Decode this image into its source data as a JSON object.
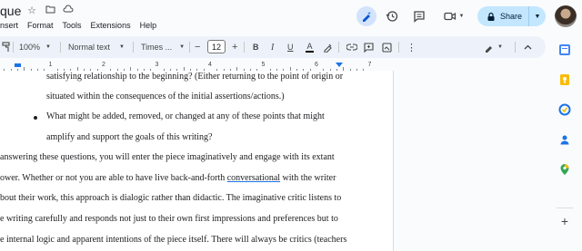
{
  "header": {
    "doc_title": "que",
    "menu": [
      "nsert",
      "Format",
      "Tools",
      "Extensions",
      "Help"
    ],
    "share_label": "Share"
  },
  "toolbar": {
    "zoom": "100%",
    "style": "Normal text",
    "font": "Times ...",
    "font_size": "12",
    "minus": "−",
    "plus": "+",
    "bold": "B",
    "italic": "I",
    "underline": "U",
    "text_color": "A"
  },
  "ruler": {
    "numbers": [
      "1",
      "2",
      "3",
      "4",
      "5",
      "6",
      "7"
    ]
  },
  "document": {
    "lines": [
      "satisfying relationship to the beginning? (Either returning to the point of origin or",
      "situated within the consequences of the initial assertions/actions.)",
      "What might be added, removed, or changed at any of these points that might",
      "amplify and support the goals of this writing?",
      "answering these questions, you will enter the piece imaginatively and engage with its extant",
      "ower. Whether or not you are able to have live back-and-forth ",
      "conversational",
      " with the writer",
      "bout their work, this approach is dialogic rather than didactic. The imaginative critic listens to",
      "e writing carefully and responds not just to their own first impressions and preferences but to",
      "e internal logic and apparent intentions of the piece itself. There will always be critics (teachers"
    ]
  },
  "colors": {
    "accent": "#1a73e8",
    "share_bg": "#c2e7ff",
    "toolbar_bg": "#edf2fa"
  }
}
